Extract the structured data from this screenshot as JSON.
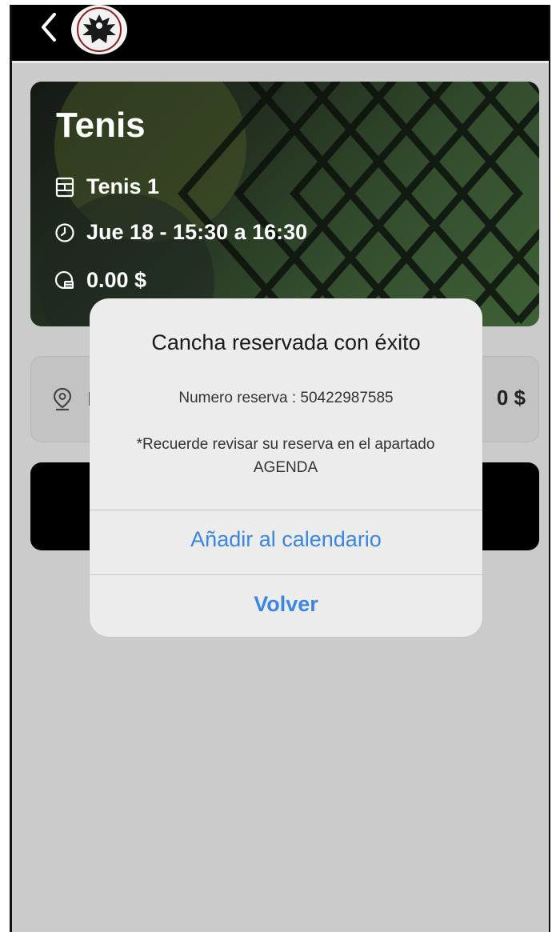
{
  "header": {
    "back_icon": "chevron-left-icon",
    "logo_icon": "eagle-crest-logo"
  },
  "booking": {
    "sport": "Tenis",
    "court": "Tenis 1",
    "datetime": "Jue 18 - 15:30 a 16:30",
    "price": "0.00 $",
    "icons": {
      "court": "court-grid-icon",
      "time": "clock-icon",
      "price": "coin-hand-icon"
    }
  },
  "summary": {
    "location_icon": "map-pin-icon",
    "location_glimpse": "l",
    "total_price": "0 $"
  },
  "dialog": {
    "title": "Cancha reservada con éxito",
    "reservation_number": "Numero reserva : 50422987585",
    "note": "*Recuerde revisar su reserva en el apartado AGENDA",
    "add_calendar_label": "Añadir al calendario",
    "back_label": "Volver"
  },
  "colors": {
    "topbar": "#000000",
    "background": "#cbcbcb",
    "dialog_bg": "#ececec",
    "action_blue": "#3a86e0"
  }
}
